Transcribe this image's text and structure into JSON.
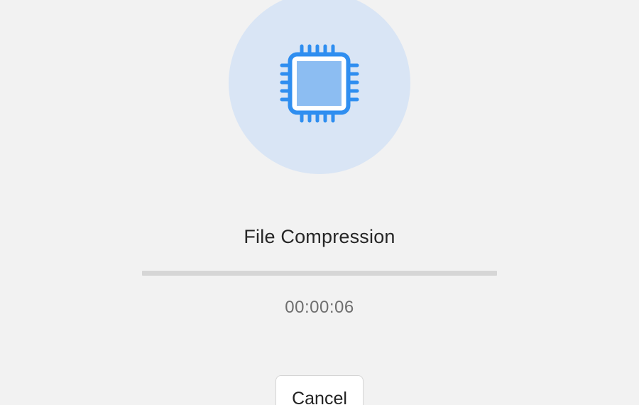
{
  "task": {
    "title": "File Compression",
    "elapsed_time": "00:00:06",
    "progress_fraction": 0.0
  },
  "actions": {
    "cancel_label": "Cancel"
  },
  "icon": {
    "name": "cpu-chip-icon",
    "circle_color": "#d9e5f5",
    "outline_color": "#2f8ef0",
    "fill_color": "#8cbdf2"
  }
}
